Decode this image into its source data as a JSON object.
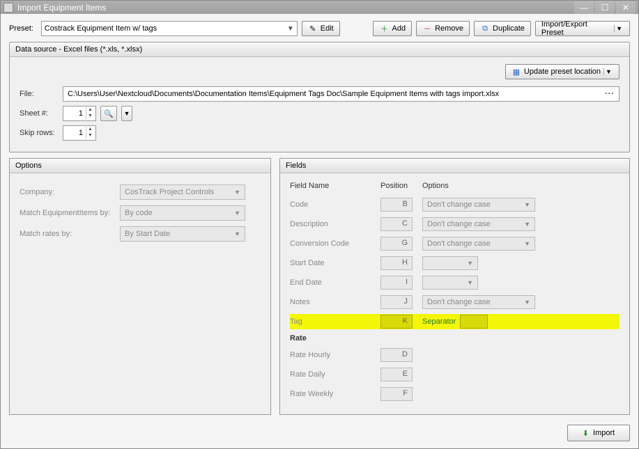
{
  "window": {
    "title": "Import Equipment Items"
  },
  "preset": {
    "label": "Preset:",
    "value": "Costrack Equipment Item w/ tags",
    "edit": "Edit",
    "add": "Add",
    "remove": "Remove",
    "duplicate": "Duplicate",
    "import_export": "Import/Export Preset"
  },
  "datasource": {
    "header": "Data source - Excel files (*.xls, *.xlsx)",
    "update_location": "Update preset location",
    "file_label": "File:",
    "file_path": "C:\\Users\\User\\Nextcloud\\Documents\\Documentation Items\\Equipment Tags Doc\\Sample Equipment Items with tags import.xlsx",
    "sheet_label": "Sheet #:",
    "sheet_value": "1",
    "skip_label": "Skip rows:",
    "skip_value": "1"
  },
  "options": {
    "header": "Options",
    "company_label": "Company:",
    "company_value": "CosTrack Project Controls",
    "match_eq_label": "Match EquipmentItems by:",
    "match_eq_value": "By code",
    "match_rates_label": "Match rates by:",
    "match_rates_value": "By Start Date"
  },
  "fields": {
    "header": "Fields",
    "col_field": "Field Name",
    "col_position": "Position",
    "col_options": "Options",
    "dont_change": "Don't change case",
    "separator_label": "Separator",
    "rows": [
      {
        "name": "Code",
        "pos": "B",
        "opt": "Don't change case"
      },
      {
        "name": "Description",
        "pos": "C",
        "opt": "Don't change case"
      },
      {
        "name": "Conversion Code",
        "pos": "G",
        "opt": "Don't change case"
      },
      {
        "name": "Start Date",
        "pos": "H",
        "opt": ""
      },
      {
        "name": "End Date",
        "pos": "I",
        "opt": ""
      },
      {
        "name": "Notes",
        "pos": "J",
        "opt": "Don't change case"
      },
      {
        "name": "Tag",
        "pos": "K",
        "opt": "",
        "highlight": true
      },
      {
        "name": "Rate",
        "bold": true
      },
      {
        "name": "Rate Hourly",
        "pos": "D"
      },
      {
        "name": "Rate Daily",
        "pos": "E"
      },
      {
        "name": "Rate Weekly",
        "pos": "F"
      }
    ]
  },
  "footer": {
    "import": "Import"
  },
  "colors": {
    "highlight": "#f4f60a"
  }
}
